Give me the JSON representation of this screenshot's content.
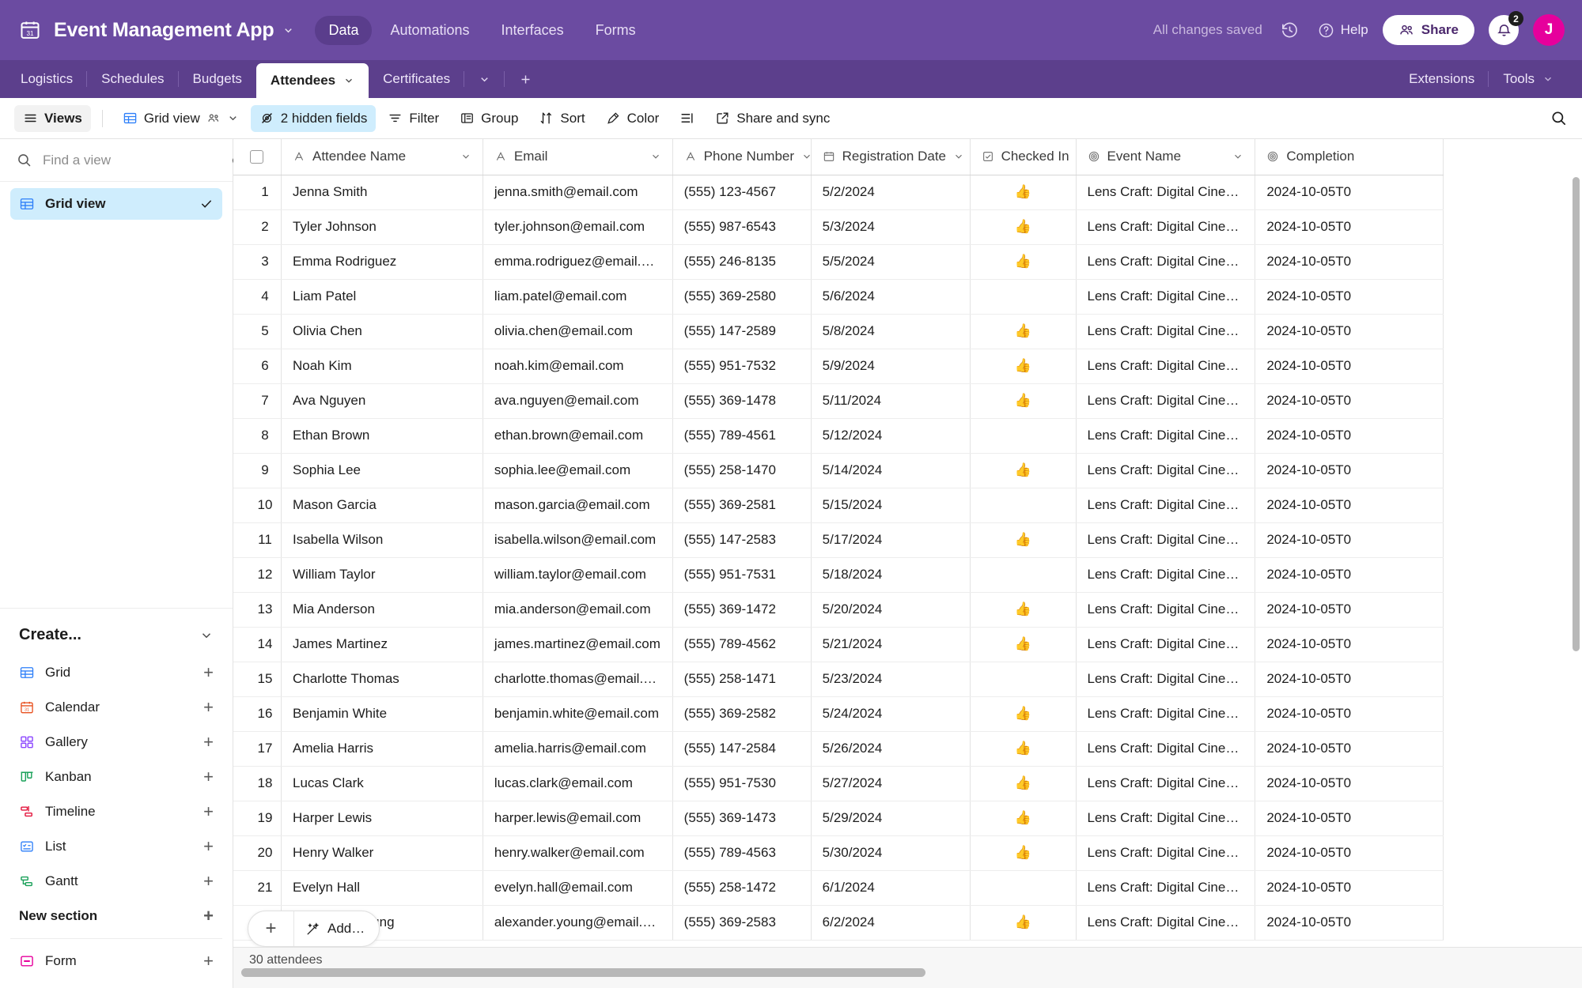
{
  "header": {
    "app_icon": "calendar-icon",
    "app_title": "Event Management App",
    "nav": [
      {
        "label": "Data",
        "active": true
      },
      {
        "label": "Automations",
        "active": false
      },
      {
        "label": "Interfaces",
        "active": false
      },
      {
        "label": "Forms",
        "active": false
      }
    ],
    "saved_status": "All changes saved",
    "history_icon": "history-icon",
    "help_label": "Help",
    "help_icon": "question-circle-icon",
    "share_label": "Share",
    "share_icon": "people-icon",
    "notification_icon": "bell-icon",
    "notification_count": "2",
    "avatar_initial": "J",
    "avatar_color": "#e6009c",
    "brand_color": "#6b4ba1"
  },
  "tabs": {
    "items": [
      {
        "label": "Logistics",
        "active": false
      },
      {
        "label": "Schedules",
        "active": false
      },
      {
        "label": "Budgets",
        "active": false
      },
      {
        "label": "Attendees",
        "active": true
      },
      {
        "label": "Certificates",
        "active": false
      }
    ],
    "overflow_icon": "chevron-down-icon",
    "add_tab_icon": "plus-icon",
    "right_items": [
      {
        "label": "Extensions"
      },
      {
        "label": "Tools"
      }
    ]
  },
  "toolbar": {
    "views_label": "Views",
    "views_icon": "menu-icon",
    "grid_view_label": "Grid view",
    "grid_view_icon": "grid-icon",
    "collaborators_icon": "people-small-icon",
    "hidden_fields_label": "2 hidden fields",
    "hidden_fields_icon": "eye-off-icon",
    "filter_label": "Filter",
    "filter_icon": "filter-icon",
    "group_label": "Group",
    "group_icon": "group-icon",
    "sort_label": "Sort",
    "sort_icon": "sort-icon",
    "color_label": "Color",
    "color_icon": "paint-icon",
    "row_height_icon": "row-height-icon",
    "share_sync_label": "Share and sync",
    "share_sync_icon": "share-external-icon",
    "search_icon": "search-icon"
  },
  "sidebar": {
    "search_placeholder": "Find a view",
    "search_value": "",
    "search_icon": "search-icon",
    "gear_icon": "gear-icon",
    "views": [
      {
        "label": "Grid view",
        "icon": "grid-icon",
        "selected": true
      }
    ],
    "create_header": "Create...",
    "create_items": [
      {
        "label": "Grid",
        "icon": "grid-icon",
        "color": "#2d7ff9"
      },
      {
        "label": "Calendar",
        "icon": "calendar-icon",
        "color": "#e8501e"
      },
      {
        "label": "Gallery",
        "icon": "gallery-icon",
        "color": "#8b46ff"
      },
      {
        "label": "Kanban",
        "icon": "kanban-icon",
        "color": "#18a058"
      },
      {
        "label": "Timeline",
        "icon": "timeline-icon",
        "color": "#e3143c"
      },
      {
        "label": "List",
        "icon": "list-icon",
        "color": "#2d7ff9"
      },
      {
        "label": "Gantt",
        "icon": "gantt-icon",
        "color": "#18a058"
      }
    ],
    "new_section_label": "New section",
    "form_item": {
      "label": "Form",
      "icon": "form-icon",
      "color": "#e6009c"
    }
  },
  "grid": {
    "columns": [
      {
        "label": "Attendee Name",
        "type_icon": "text-icon"
      },
      {
        "label": "Email",
        "type_icon": "text-icon"
      },
      {
        "label": "Phone Number",
        "type_icon": "text-icon"
      },
      {
        "label": "Registration Date",
        "type_icon": "calendar-icon"
      },
      {
        "label": "Checked In",
        "type_icon": "checkbox-icon"
      },
      {
        "label": "Event Name",
        "type_icon": "link-record-icon"
      },
      {
        "label": "Completion",
        "type_icon": "link-record-icon"
      }
    ],
    "checked_in_glyph": "👍",
    "rows": [
      {
        "num": "1",
        "name": "Jenna Smith",
        "email": "jenna.smith@email.com",
        "phone": "(555) 123-4567",
        "date": "5/2/2024",
        "checked": true,
        "event": "Lens Craft: Digital Cinem…",
        "completion": "2024-10-05T0"
      },
      {
        "num": "2",
        "name": "Tyler Johnson",
        "email": "tyler.johnson@email.com",
        "phone": "(555) 987-6543",
        "date": "5/3/2024",
        "checked": true,
        "event": "Lens Craft: Digital Cinem…",
        "completion": "2024-10-05T0"
      },
      {
        "num": "3",
        "name": "Emma Rodriguez",
        "email": "emma.rodriguez@email.com",
        "phone": "(555) 246-8135",
        "date": "5/5/2024",
        "checked": true,
        "event": "Lens Craft: Digital Cinem…",
        "completion": "2024-10-05T0"
      },
      {
        "num": "4",
        "name": "Liam Patel",
        "email": "liam.patel@email.com",
        "phone": "(555) 369-2580",
        "date": "5/6/2024",
        "checked": false,
        "event": "Lens Craft: Digital Cinem…",
        "completion": "2024-10-05T0"
      },
      {
        "num": "5",
        "name": "Olivia Chen",
        "email": "olivia.chen@email.com",
        "phone": "(555) 147-2589",
        "date": "5/8/2024",
        "checked": true,
        "event": "Lens Craft: Digital Cinem…",
        "completion": "2024-10-05T0"
      },
      {
        "num": "6",
        "name": "Noah Kim",
        "email": "noah.kim@email.com",
        "phone": "(555) 951-7532",
        "date": "5/9/2024",
        "checked": true,
        "event": "Lens Craft: Digital Cinem…",
        "completion": "2024-10-05T0"
      },
      {
        "num": "7",
        "name": "Ava Nguyen",
        "email": "ava.nguyen@email.com",
        "phone": "(555) 369-1478",
        "date": "5/11/2024",
        "checked": true,
        "event": "Lens Craft: Digital Cinem…",
        "completion": "2024-10-05T0"
      },
      {
        "num": "8",
        "name": "Ethan Brown",
        "email": "ethan.brown@email.com",
        "phone": "(555) 789-4561",
        "date": "5/12/2024",
        "checked": false,
        "event": "Lens Craft: Digital Cinem…",
        "completion": "2024-10-05T0"
      },
      {
        "num": "9",
        "name": "Sophia Lee",
        "email": "sophia.lee@email.com",
        "phone": "(555) 258-1470",
        "date": "5/14/2024",
        "checked": true,
        "event": "Lens Craft: Digital Cinem…",
        "completion": "2024-10-05T0"
      },
      {
        "num": "10",
        "name": "Mason Garcia",
        "email": "mason.garcia@email.com",
        "phone": "(555) 369-2581",
        "date": "5/15/2024",
        "checked": false,
        "event": "Lens Craft: Digital Cinem…",
        "completion": "2024-10-05T0"
      },
      {
        "num": "11",
        "name": "Isabella Wilson",
        "email": "isabella.wilson@email.com",
        "phone": "(555) 147-2583",
        "date": "5/17/2024",
        "checked": true,
        "event": "Lens Craft: Digital Cinem…",
        "completion": "2024-10-05T0"
      },
      {
        "num": "12",
        "name": "William Taylor",
        "email": "william.taylor@email.com",
        "phone": "(555) 951-7531",
        "date": "5/18/2024",
        "checked": false,
        "event": "Lens Craft: Digital Cinem…",
        "completion": "2024-10-05T0"
      },
      {
        "num": "13",
        "name": "Mia Anderson",
        "email": "mia.anderson@email.com",
        "phone": "(555) 369-1472",
        "date": "5/20/2024",
        "checked": true,
        "event": "Lens Craft: Digital Cinem…",
        "completion": "2024-10-05T0"
      },
      {
        "num": "14",
        "name": "James Martinez",
        "email": "james.martinez@email.com",
        "phone": "(555) 789-4562",
        "date": "5/21/2024",
        "checked": true,
        "event": "Lens Craft: Digital Cinem…",
        "completion": "2024-10-05T0"
      },
      {
        "num": "15",
        "name": "Charlotte Thomas",
        "email": "charlotte.thomas@email.com",
        "phone": "(555) 258-1471",
        "date": "5/23/2024",
        "checked": false,
        "event": "Lens Craft: Digital Cinem…",
        "completion": "2024-10-05T0"
      },
      {
        "num": "16",
        "name": "Benjamin White",
        "email": "benjamin.white@email.com",
        "phone": "(555) 369-2582",
        "date": "5/24/2024",
        "checked": true,
        "event": "Lens Craft: Digital Cinem…",
        "completion": "2024-10-05T0"
      },
      {
        "num": "17",
        "name": "Amelia Harris",
        "email": "amelia.harris@email.com",
        "phone": "(555) 147-2584",
        "date": "5/26/2024",
        "checked": true,
        "event": "Lens Craft: Digital Cinem…",
        "completion": "2024-10-05T0"
      },
      {
        "num": "18",
        "name": "Lucas Clark",
        "email": "lucas.clark@email.com",
        "phone": "(555) 951-7530",
        "date": "5/27/2024",
        "checked": true,
        "event": "Lens Craft: Digital Cinem…",
        "completion": "2024-10-05T0"
      },
      {
        "num": "19",
        "name": "Harper Lewis",
        "email": "harper.lewis@email.com",
        "phone": "(555) 369-1473",
        "date": "5/29/2024",
        "checked": true,
        "event": "Lens Craft: Digital Cinem…",
        "completion": "2024-10-05T0"
      },
      {
        "num": "20",
        "name": "Henry Walker",
        "email": "henry.walker@email.com",
        "phone": "(555) 789-4563",
        "date": "5/30/2024",
        "checked": true,
        "event": "Lens Craft: Digital Cinem…",
        "completion": "2024-10-05T0"
      },
      {
        "num": "21",
        "name": "Evelyn Hall",
        "email": "evelyn.hall@email.com",
        "phone": "(555) 258-1472",
        "date": "6/1/2024",
        "checked": false,
        "event": "Lens Craft: Digital Cinem…",
        "completion": "2024-10-05T0"
      },
      {
        "num": "22",
        "name": "Alexander Young",
        "email": "alexander.young@email.com",
        "phone": "(555) 369-2583",
        "date": "6/2/2024",
        "checked": true,
        "event": "Lens Craft: Digital Cinem…",
        "completion": "2024-10-05T0"
      }
    ],
    "add_row_label": "Add…",
    "add_row_icon": "magic-wand-icon",
    "add_plus_icon": "plus-icon",
    "footer_count": "30 attendees"
  }
}
